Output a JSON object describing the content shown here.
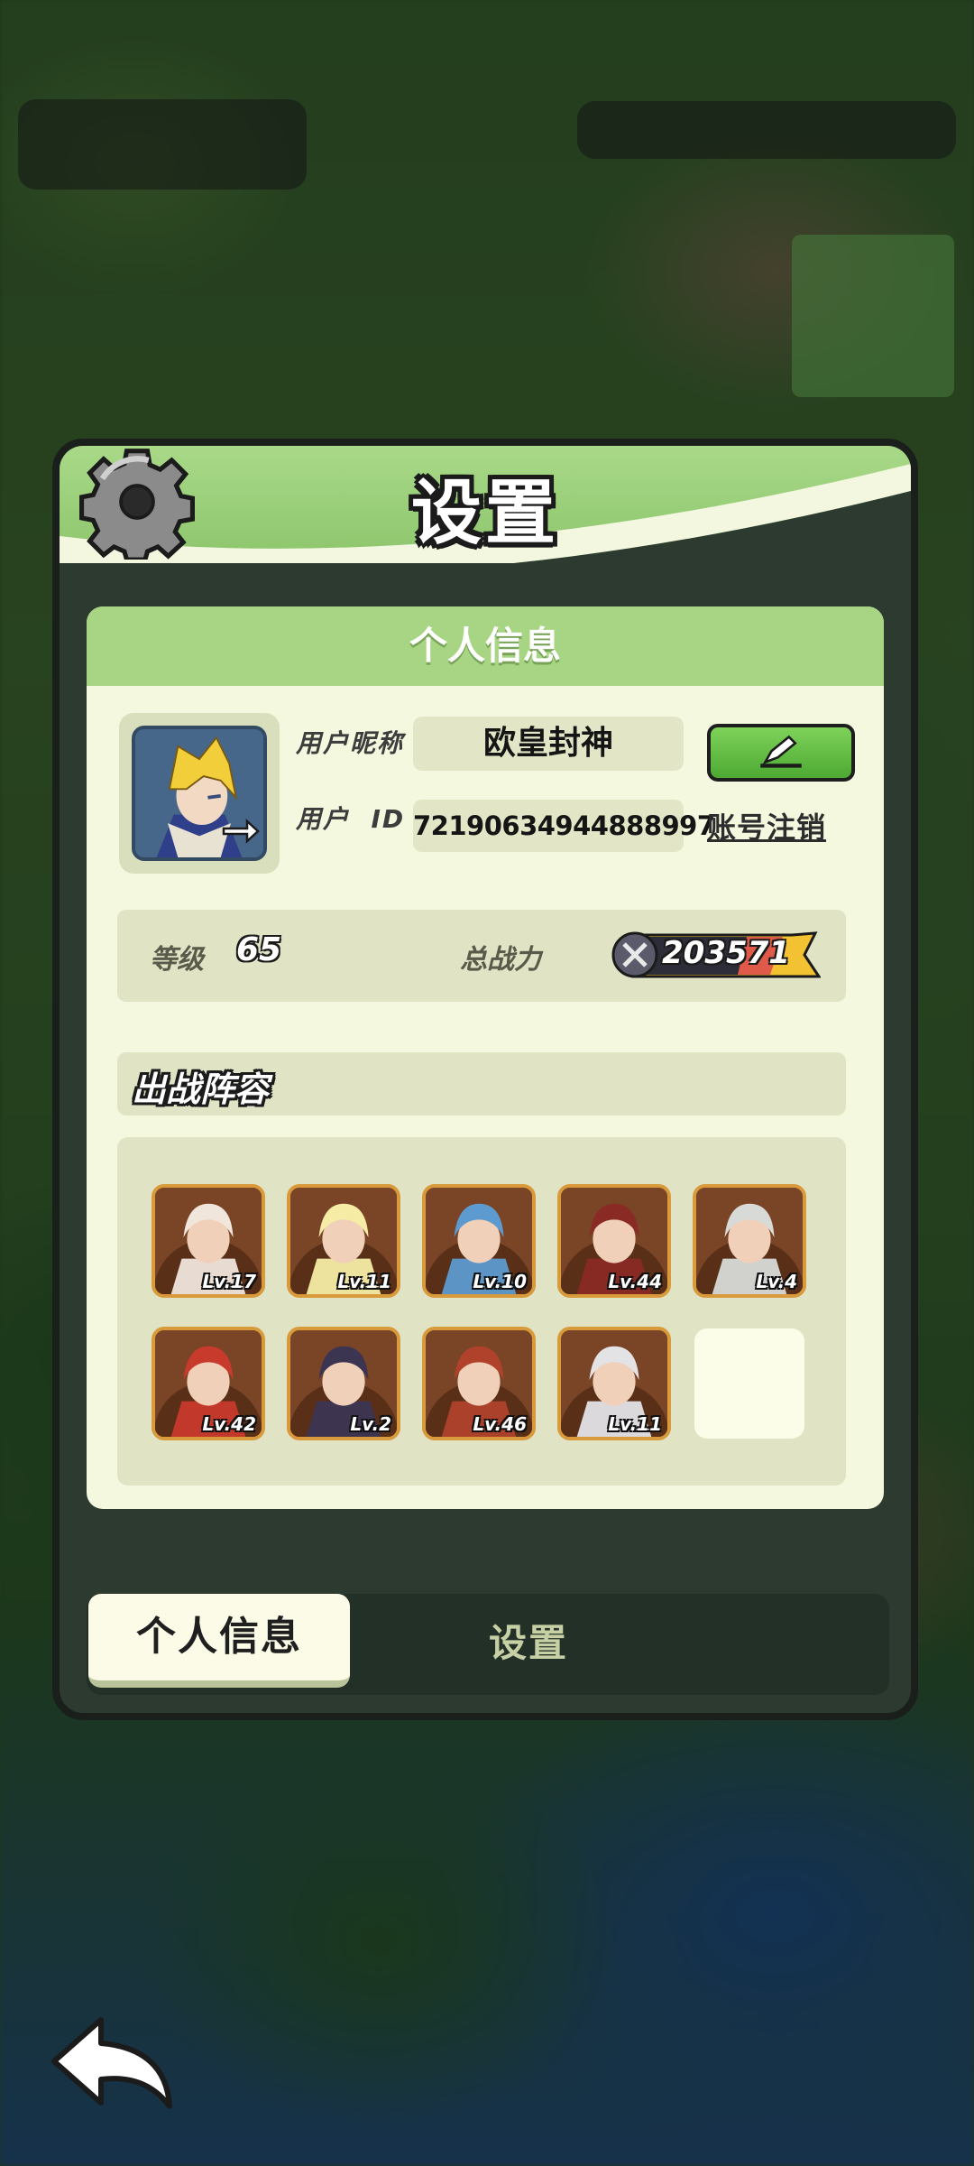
{
  "panel": {
    "title": "设置"
  },
  "profile": {
    "section_title": "个人信息",
    "nickname_label": "用户昵称",
    "nickname": "欧皇封神",
    "id_label": "用户  ID",
    "user_id": "72190634944888997",
    "cancel_account_label": "账号注销"
  },
  "stats": {
    "level_label": "等级",
    "level": "65",
    "power_label": "总战力",
    "power": "203571"
  },
  "lineup": {
    "title": "出战阵容",
    "heroes": [
      {
        "level": "Lv.17",
        "color": "#f0e6dc"
      },
      {
        "level": "Lv.11",
        "color": "#f7eca6"
      },
      {
        "level": "Lv.10",
        "color": "#5d9ad0"
      },
      {
        "level": "Lv.44",
        "color": "#8a2a25"
      },
      {
        "level": "Lv.4",
        "color": "#d8dad8"
      },
      {
        "level": "Lv.42",
        "color": "#c83a2c"
      },
      {
        "level": "Lv.2",
        "color": "#3c3552"
      },
      {
        "level": "Lv.46",
        "color": "#b0422c"
      },
      {
        "level": "Lv.11",
        "color": "#e3e3e6"
      }
    ]
  },
  "tabs": {
    "active": "个人信息",
    "inactive": "设置"
  },
  "colors": {
    "accent_green": "#8cc56c",
    "card_bg": "#f3f8df",
    "frame_orange": "#d99a3c"
  }
}
